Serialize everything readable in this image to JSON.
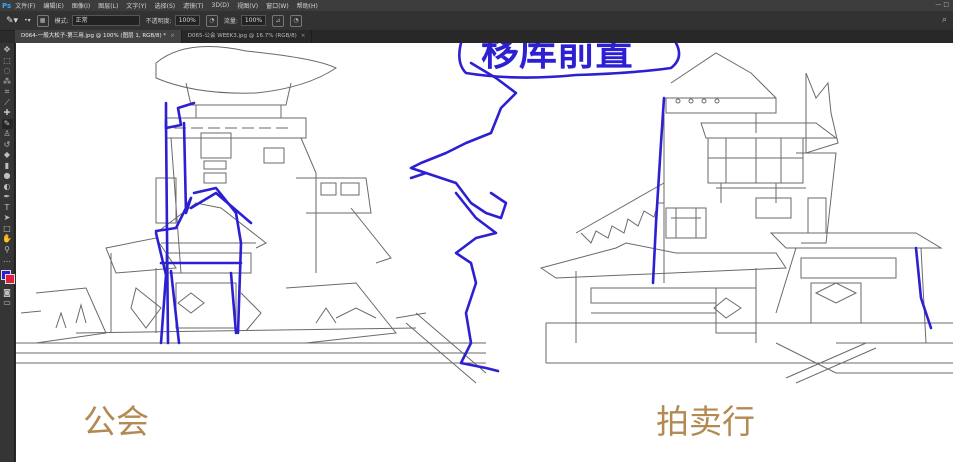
{
  "app": {
    "logo": "Ps"
  },
  "menu": [
    "文件(F)",
    "编辑(E)",
    "图像(I)",
    "图层(L)",
    "文字(Y)",
    "选择(S)",
    "滤镜(T)",
    "3D(D)",
    "视图(V)",
    "窗口(W)",
    "帮助(H)"
  ],
  "window_controls": "—  □",
  "options": {
    "mode_label": "模式:",
    "mode_value": "正常",
    "opacity_label": "不透明度:",
    "opacity_value": "100%",
    "flow_label": "流量:",
    "flow_value": "100%"
  },
  "tabs": [
    {
      "label": "D064-一般大松子-第三用.jpg @ 100% (图层 1, RGB/8) *",
      "active": true
    },
    {
      "label": "D065-公会 WEEK3.jpg @ 16.7% (RGB/8)",
      "active": false
    }
  ],
  "tab_close": "×",
  "canvas": {
    "handwritten_note": "移库前置",
    "caption_left": "公会",
    "caption_right": "拍卖行",
    "caption_color": "#b38a52",
    "annotation_color": "#2d1fd2"
  },
  "colors": {
    "foreground": "#2d1fd2",
    "background": "#e0203a"
  }
}
